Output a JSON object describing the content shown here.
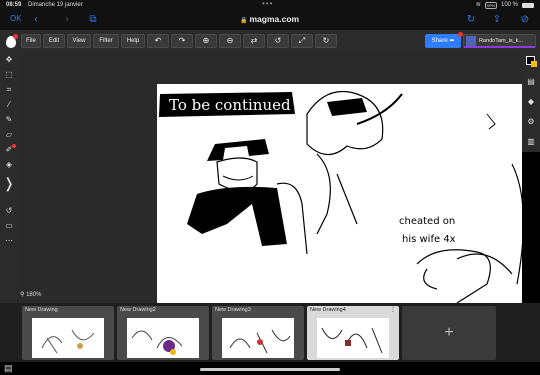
{
  "status_bar": {
    "time": "08:59",
    "date": "Dimanche 19 janvier",
    "vpn": "VPN",
    "battery": "100 %"
  },
  "browser": {
    "done_label": "OK",
    "url": "magma.com"
  },
  "toolbar": {
    "menus": [
      "File",
      "Edit",
      "View",
      "Filter",
      "Help"
    ],
    "share_label": "Share",
    "username": "RandoTam_is_k...",
    "colors": {
      "accent": "#2f7df6",
      "user_underline": "#8c3bd8",
      "notification": "#e33333"
    }
  },
  "canvas": {
    "zoom": "180%",
    "text_banner": "To be continued",
    "text_note_line1": "cheated on",
    "text_note_line2": "his wife 4x"
  },
  "drawings": [
    {
      "title": "New Drawing",
      "active": false
    },
    {
      "title": "New Drawing2",
      "active": false
    },
    {
      "title": "New Drawing3",
      "active": false
    },
    {
      "title": "New Drawing4",
      "active": true
    }
  ],
  "add_label": "+"
}
